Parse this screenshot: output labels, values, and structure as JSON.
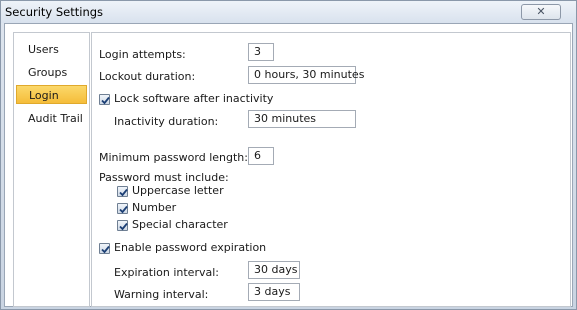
{
  "window": {
    "title": "Security Settings",
    "close_glyph": "✕"
  },
  "nav": {
    "items": [
      {
        "label": "Users"
      },
      {
        "label": "Groups"
      },
      {
        "label": "Login",
        "selected": true
      },
      {
        "label": "Audit Trail"
      }
    ]
  },
  "login": {
    "login_attempts": {
      "label": "Login attempts:",
      "value": "3"
    },
    "lockout_duration": {
      "label": "Lockout duration:",
      "value": "0 hours, 30 minutes"
    },
    "lock_after_inactivity": {
      "label": "Lock software after inactivity",
      "checked": true
    },
    "inactivity_duration": {
      "label": "Inactivity duration:",
      "value": "30 minutes"
    },
    "min_password_length": {
      "label": "Minimum password length:",
      "value": "6"
    },
    "password_must_include": {
      "label": "Password must include:",
      "uppercase": {
        "label": "Uppercase letter",
        "checked": true
      },
      "number": {
        "label": "Number",
        "checked": true
      },
      "special": {
        "label": "Special character",
        "checked": true
      }
    },
    "password_expiration": {
      "label": "Enable password expiration",
      "checked": true
    },
    "expiration_interval": {
      "label": "Expiration interval:",
      "value": "30 days"
    },
    "warning_interval": {
      "label": "Warning interval:",
      "value": "3 days"
    }
  },
  "colors": {
    "selected_nav": "#f5bd3a",
    "checkmark": "#1c3f75"
  }
}
